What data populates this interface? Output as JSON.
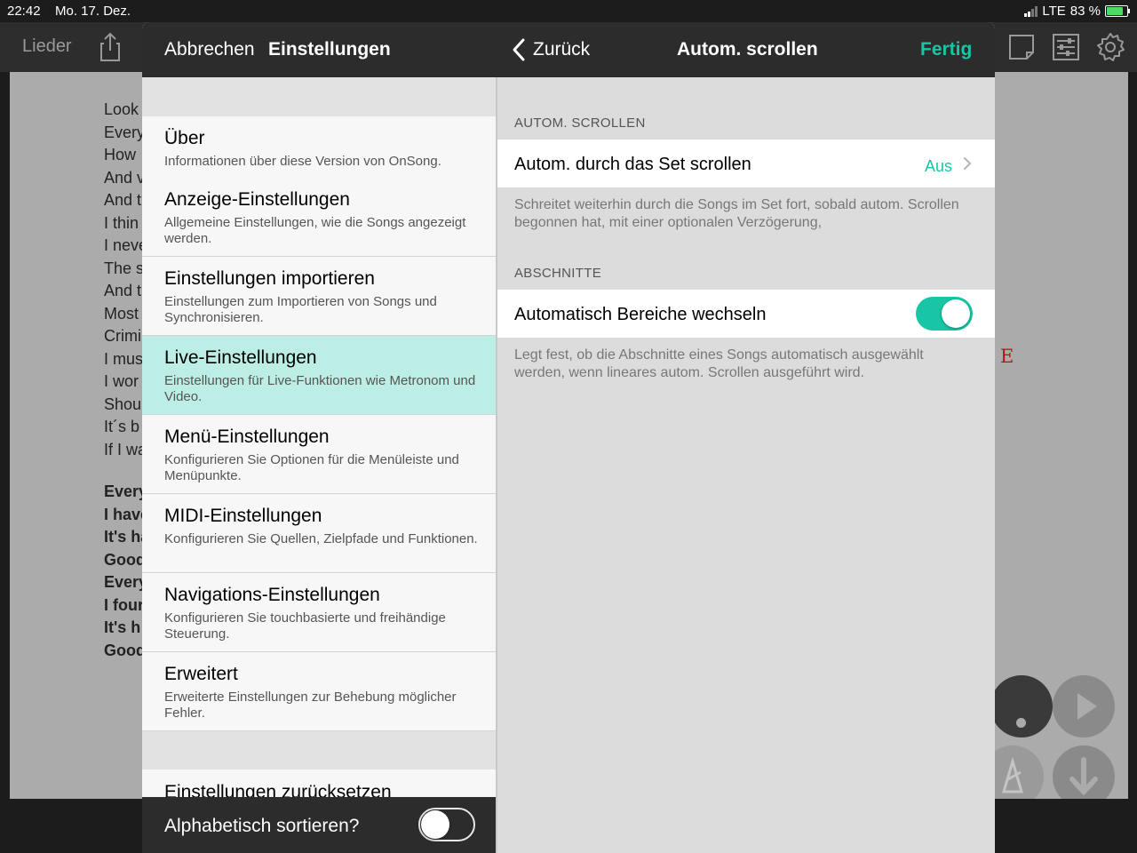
{
  "status_bar": {
    "time": "22:42",
    "date": "Mo. 17. Dez.",
    "network": "LTE",
    "battery": "83 %"
  },
  "background_app": {
    "songs_tab_label": "Lieder",
    "toolbar_icons": [
      "share-icon",
      "note-icon",
      "sliders-icon",
      "gear-icon"
    ],
    "lyrics_regular": [
      "Look",
      "Every",
      "How",
      "And v",
      "And t",
      "I thin",
      "I neve",
      "The s",
      "And t",
      "Most",
      "Crimi",
      "I mus",
      "I wor",
      "Shou",
      "It´s b",
      "If I wa"
    ],
    "lyrics_bold": [
      "Every",
      "I have",
      "It's ha",
      "Good",
      "Every",
      "I four",
      "It's h",
      "Good"
    ],
    "chord_visible": "E",
    "controls": [
      "record-icon",
      "play-icon",
      "metronome-icon",
      "down-arrow-icon"
    ]
  },
  "settings_modal": {
    "cancel_label": "Abbrechen",
    "title": "Einstellungen",
    "back_label": "Zurück",
    "detail_title": "Autom. scrollen",
    "done_label": "Fertig",
    "accent_color": "#18c6a6",
    "menu_items": [
      {
        "title": "Über",
        "desc": "Informationen über diese Version von OnSong."
      },
      {
        "title": "Anzeige-Einstellungen",
        "desc": "Allgemeine Einstellungen, wie die Songs angezeigt werden."
      },
      {
        "title": "Einstellungen importieren",
        "desc": "Einstellungen zum Importieren von Songs und Synchronisieren."
      },
      {
        "title": "Live-Einstellungen",
        "desc": "Einstellungen für Live-Funktionen wie Metronom und Video."
      },
      {
        "title": "Menü-Einstellungen",
        "desc": "Konfigurieren Sie Optionen für die Menüleiste und Menüpunkte."
      },
      {
        "title": "MIDI-Einstellungen",
        "desc": "Konfigurieren Sie Quellen, Zielpfade und Funktionen."
      },
      {
        "title": "Navigations-Einstellungen",
        "desc": "Konfigurieren Sie touchbasierte und freihändige Steuerung."
      },
      {
        "title": "Erweitert",
        "desc": "Erweiterte Einstellungen zur Behebung möglicher Fehler."
      }
    ],
    "selected_index": 3,
    "reset_label": "Einstellungen zurücksetzen",
    "sort_label": "Alphabetisch sortieren?",
    "sort_enabled": false,
    "detail": {
      "section1_header": "AUTOM. SCROLLEN",
      "set_scroll_label": "Autom. durch das Set scrollen",
      "set_scroll_value": "Aus",
      "set_scroll_footer": "Schreitet weiterhin durch die Songs im Set fort, sobald autom. Scrollen begonnen hat, mit einer optionalen Verzögerung,",
      "section2_header": "ABSCHNITTE",
      "auto_sections_label": "Automatisch Bereiche wechseln",
      "auto_sections_enabled": true,
      "auto_sections_footer": "Legt fest, ob die Abschnitte eines Songs automatisch ausgewählt werden, wenn lineares autom. Scrollen ausgeführt wird."
    }
  }
}
